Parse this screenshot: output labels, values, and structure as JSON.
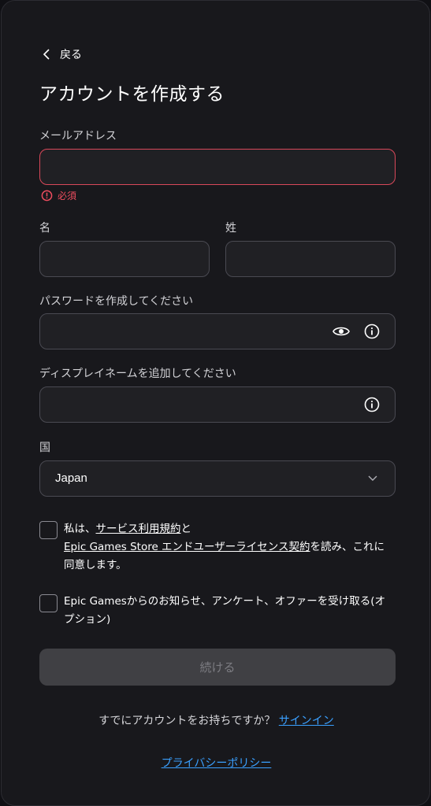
{
  "back_label": "戻る",
  "title": "アカウントを作成する",
  "email": {
    "label": "メールアドレス",
    "value": "",
    "error": "必須"
  },
  "first_name": {
    "label": "名",
    "value": ""
  },
  "last_name": {
    "label": "姓",
    "value": ""
  },
  "password": {
    "label": "パスワードを作成してください",
    "value": ""
  },
  "display_name": {
    "label": "ディスプレイネームを追加してください",
    "value": ""
  },
  "country": {
    "label": "国",
    "selected": "Japan"
  },
  "terms": {
    "prefix": "私は、",
    "link1": "サービス利用規約",
    "mid": "と",
    "link2": "Epic Games Store エンドユーザーライセンス契約",
    "suffix1": "を読み、これに",
    "suffix2": "同意します。",
    "checked": false
  },
  "marketing": {
    "text1": "Epic Gamesからのお知らせ、アンケート、オファーを受け取る(オ",
    "text2": "プション)",
    "checked": false
  },
  "submit_label": "続ける",
  "signin": {
    "prompt": "すでにアカウントをお持ちですか？",
    "link": "サインイン"
  },
  "privacy_link": "プライバシーポリシー",
  "colors": {
    "error": "#ee4d5f",
    "link": "#3aa0ff",
    "card": "#18181c"
  }
}
